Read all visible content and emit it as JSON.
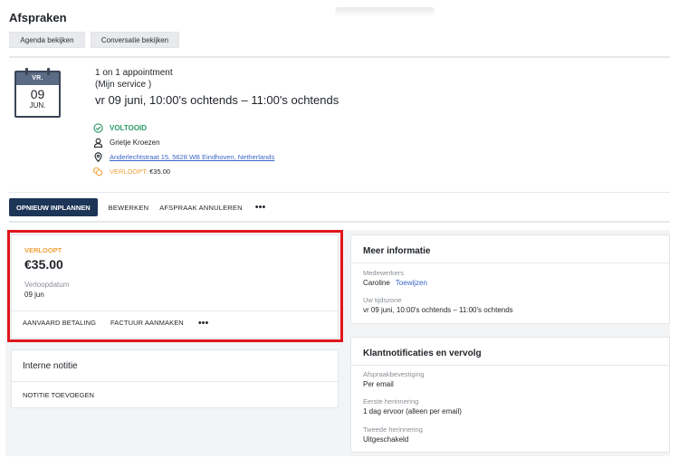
{
  "page": {
    "title": "Afspraken"
  },
  "top_buttons": {
    "agenda": "Agenda bekijken",
    "conversation": "Conversatie bekijken"
  },
  "appointment": {
    "calendar": {
      "weekday": "VR.",
      "day": "09",
      "month": "JUN."
    },
    "name": "1 on 1 appointment",
    "service": "(Mijn service )",
    "when": "vr 09 juni, 10:00's ochtends – 11:00's ochtends",
    "status": "VOLTOOID",
    "person": "Grietje Kroezen",
    "address": "Anderlechtstraat 15, 5628 WB Eindhoven, Netherlands",
    "due_label": "VERLOOPT:",
    "due_amount": "€35.00"
  },
  "actions": {
    "reschedule": "OPNIEUW INPLANNEN",
    "edit": "BEWERKEN",
    "cancel": "AFSPRAAK ANNULEREN",
    "more": "•••"
  },
  "payment": {
    "status": "VERLOOPT",
    "amount": "€35.00",
    "date_label": "Verloopdatum",
    "date": "09 jun",
    "accept": "AANVAARD BETALING",
    "invoice": "FACTUUR AANMAKEN",
    "more": "•••"
  },
  "note": {
    "title": "Interne notitie",
    "add": "NOTITIE TOEVOEGEN"
  },
  "more_info": {
    "title": "Meer informatie",
    "staff_label": "Medewerkers",
    "staff_value": "Caroline",
    "assign": "Toewijzen",
    "tz_label": "Uw tijdszone",
    "tz_value": "vr 09 juni, 10:00's ochtends – 11:00's ochtends"
  },
  "notifications": {
    "title": "Klantnotificaties en vervolg",
    "confirm_label": "Afspraakbevestiging",
    "confirm_value": "Per email",
    "first_label": "Eerste herinnering",
    "first_value": "1 dag ervoor (alleen per email)",
    "second_label": "Tweede herinnering",
    "second_value": "Uitgeschakeld"
  },
  "colors": {
    "primary": "#1d3557",
    "success": "#2e9a6b",
    "warning": "#f0a23a",
    "link": "#3a66c8",
    "highlight": "#e0161d"
  },
  "icons": {
    "status": "check-circle-icon",
    "person": "person-icon",
    "address": "map-pin-icon",
    "due": "coins-icon"
  }
}
